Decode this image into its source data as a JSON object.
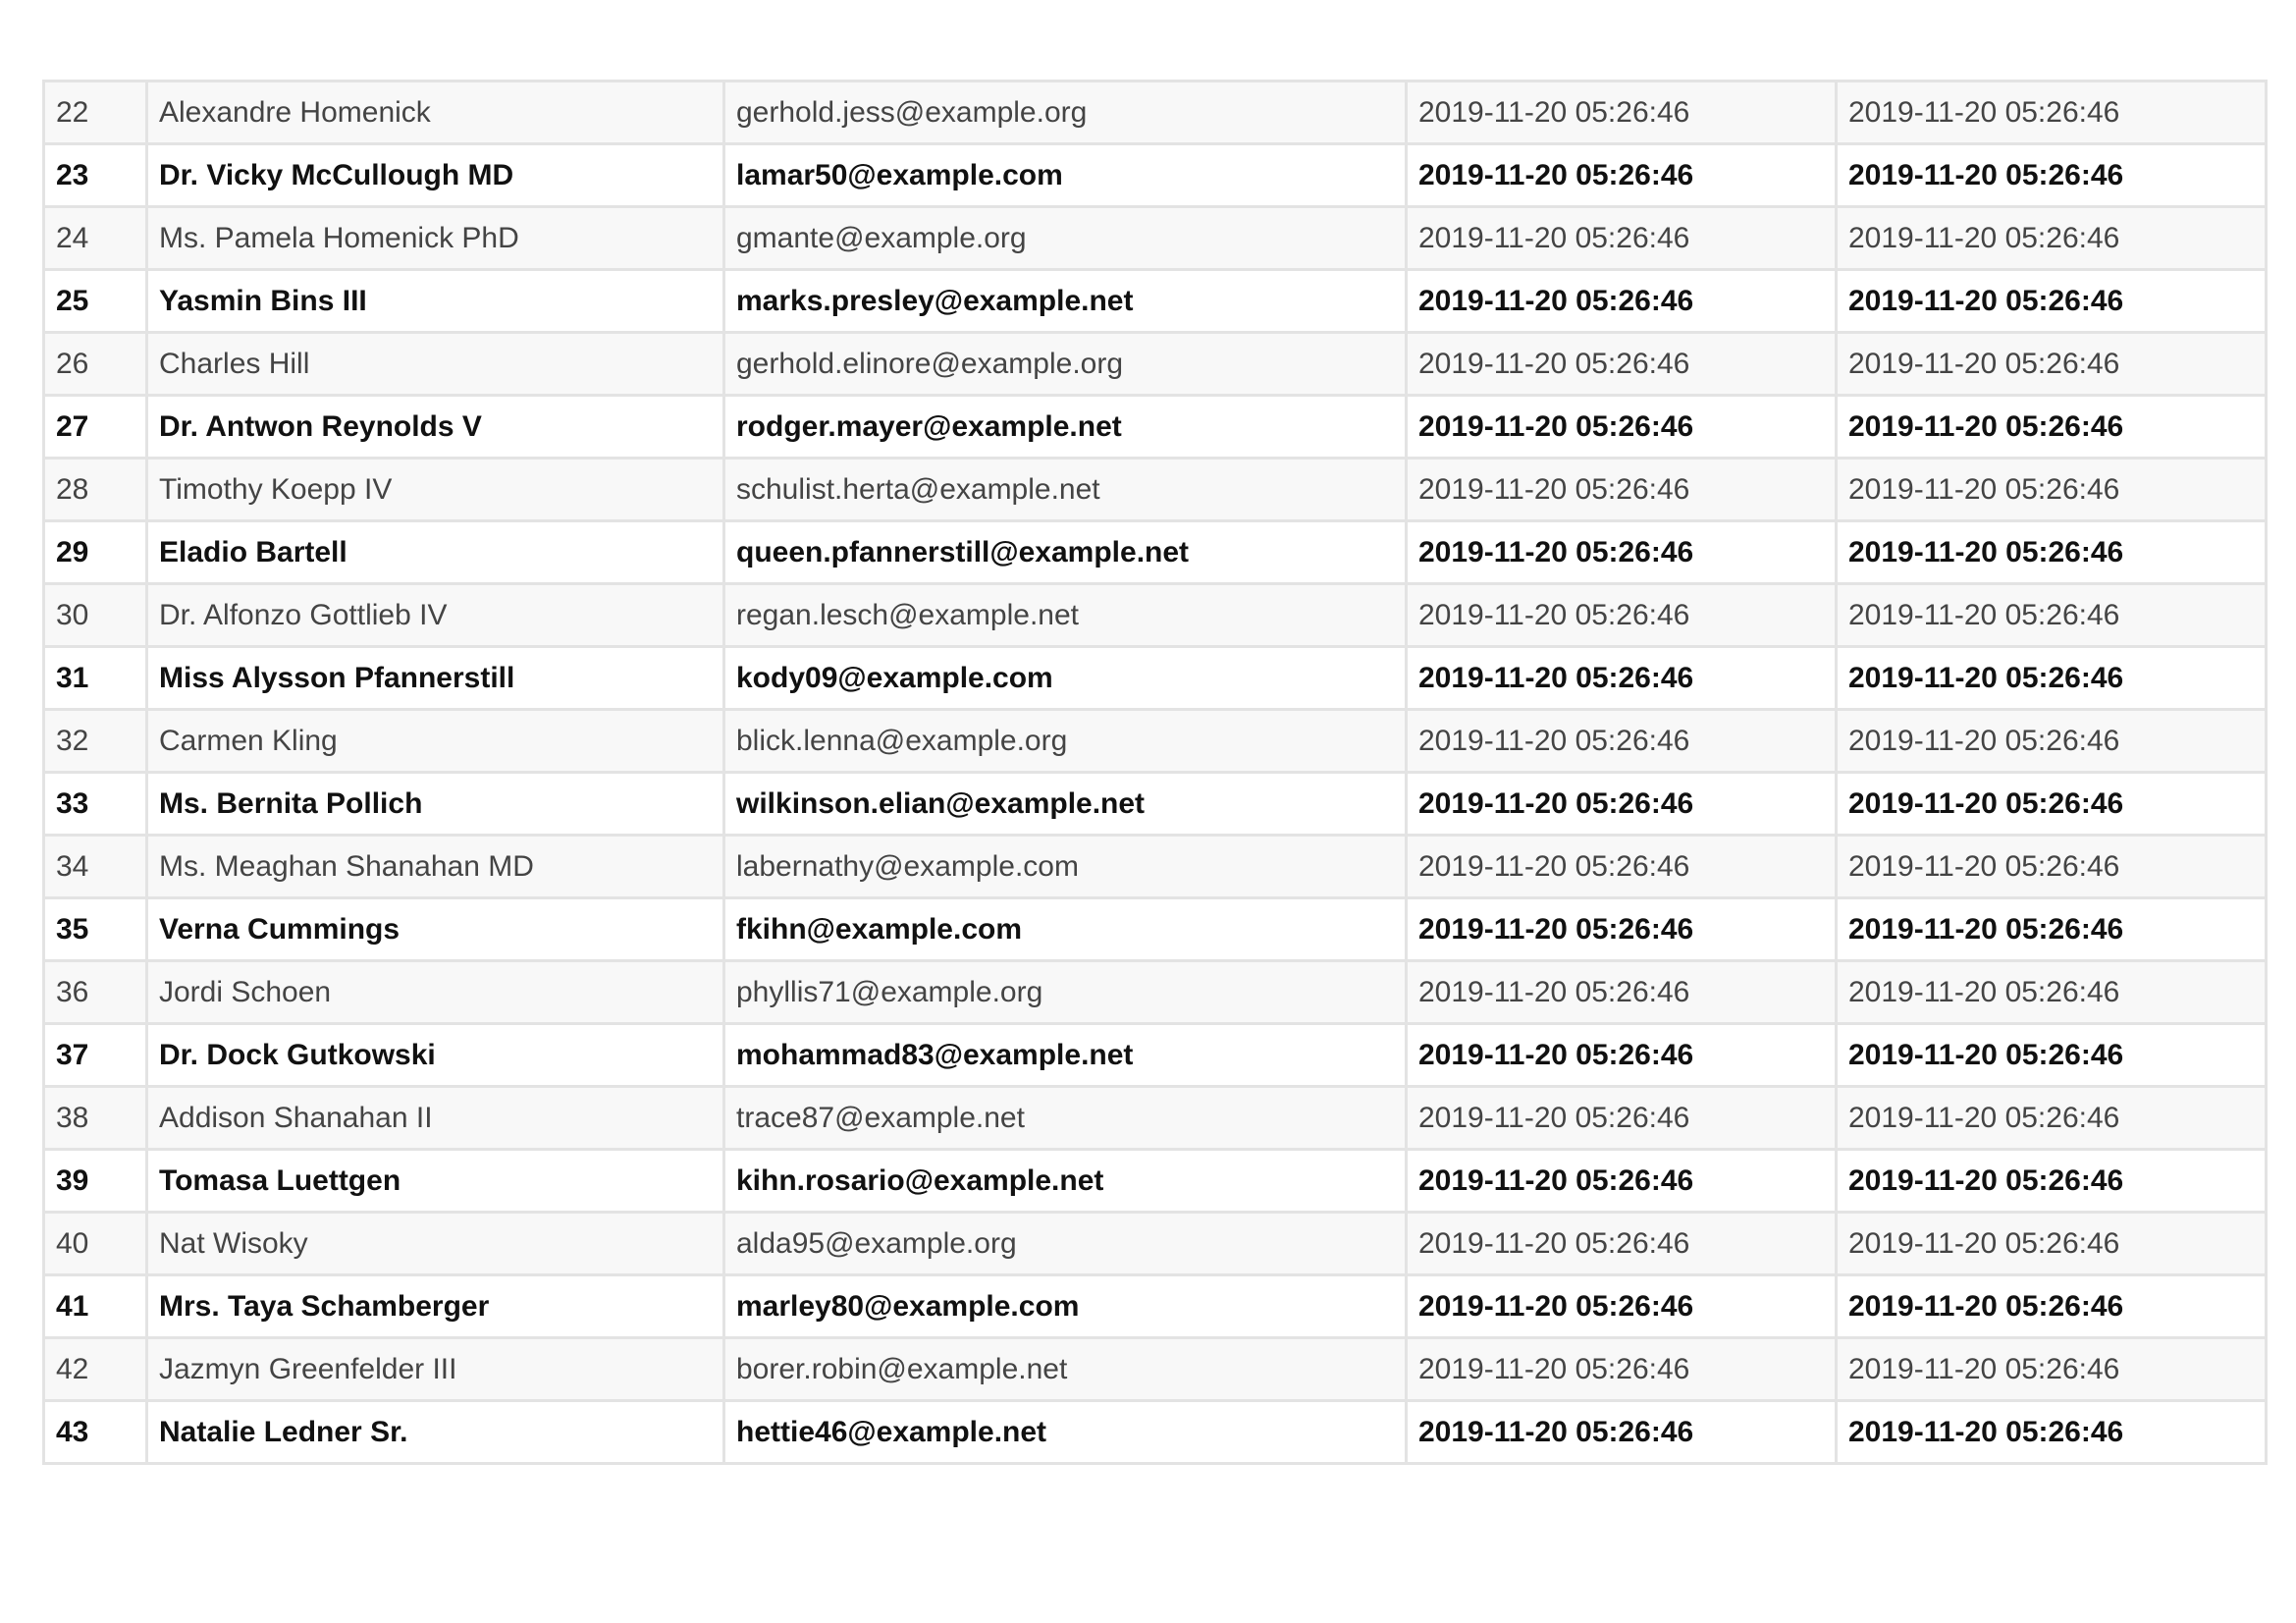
{
  "table": {
    "rows": [
      {
        "id": "22",
        "name": "Alexandre Homenick",
        "email": "gerhold.jess@example.org",
        "created_at": "2019-11-20 05:26:46",
        "updated_at": "2019-11-20 05:26:46"
      },
      {
        "id": "23",
        "name": "Dr. Vicky McCullough MD",
        "email": "lamar50@example.com",
        "created_at": "2019-11-20 05:26:46",
        "updated_at": "2019-11-20 05:26:46"
      },
      {
        "id": "24",
        "name": "Ms. Pamela Homenick PhD",
        "email": "gmante@example.org",
        "created_at": "2019-11-20 05:26:46",
        "updated_at": "2019-11-20 05:26:46"
      },
      {
        "id": "25",
        "name": "Yasmin Bins III",
        "email": "marks.presley@example.net",
        "created_at": "2019-11-20 05:26:46",
        "updated_at": "2019-11-20 05:26:46"
      },
      {
        "id": "26",
        "name": "Charles Hill",
        "email": "gerhold.elinore@example.org",
        "created_at": "2019-11-20 05:26:46",
        "updated_at": "2019-11-20 05:26:46"
      },
      {
        "id": "27",
        "name": "Dr. Antwon Reynolds V",
        "email": "rodger.mayer@example.net",
        "created_at": "2019-11-20 05:26:46",
        "updated_at": "2019-11-20 05:26:46"
      },
      {
        "id": "28",
        "name": "Timothy Koepp IV",
        "email": "schulist.herta@example.net",
        "created_at": "2019-11-20 05:26:46",
        "updated_at": "2019-11-20 05:26:46"
      },
      {
        "id": "29",
        "name": "Eladio Bartell",
        "email": "queen.pfannerstill@example.net",
        "created_at": "2019-11-20 05:26:46",
        "updated_at": "2019-11-20 05:26:46"
      },
      {
        "id": "30",
        "name": "Dr. Alfonzo Gottlieb IV",
        "email": "regan.lesch@example.net",
        "created_at": "2019-11-20 05:26:46",
        "updated_at": "2019-11-20 05:26:46"
      },
      {
        "id": "31",
        "name": "Miss Alysson Pfannerstill",
        "email": "kody09@example.com",
        "created_at": "2019-11-20 05:26:46",
        "updated_at": "2019-11-20 05:26:46"
      },
      {
        "id": "32",
        "name": "Carmen Kling",
        "email": "blick.lenna@example.org",
        "created_at": "2019-11-20 05:26:46",
        "updated_at": "2019-11-20 05:26:46"
      },
      {
        "id": "33",
        "name": "Ms. Bernita Pollich",
        "email": "wilkinson.elian@example.net",
        "created_at": "2019-11-20 05:26:46",
        "updated_at": "2019-11-20 05:26:46"
      },
      {
        "id": "34",
        "name": "Ms. Meaghan Shanahan MD",
        "email": "labernathy@example.com",
        "created_at": "2019-11-20 05:26:46",
        "updated_at": "2019-11-20 05:26:46"
      },
      {
        "id": "35",
        "name": "Verna Cummings",
        "email": "fkihn@example.com",
        "created_at": "2019-11-20 05:26:46",
        "updated_at": "2019-11-20 05:26:46"
      },
      {
        "id": "36",
        "name": "Jordi Schoen",
        "email": "phyllis71@example.org",
        "created_at": "2019-11-20 05:26:46",
        "updated_at": "2019-11-20 05:26:46"
      },
      {
        "id": "37",
        "name": "Dr. Dock Gutkowski",
        "email": "mohammad83@example.net",
        "created_at": "2019-11-20 05:26:46",
        "updated_at": "2019-11-20 05:26:46"
      },
      {
        "id": "38",
        "name": "Addison Shanahan II",
        "email": "trace87@example.net",
        "created_at": "2019-11-20 05:26:46",
        "updated_at": "2019-11-20 05:26:46"
      },
      {
        "id": "39",
        "name": "Tomasa Luettgen",
        "email": "kihn.rosario@example.net",
        "created_at": "2019-11-20 05:26:46",
        "updated_at": "2019-11-20 05:26:46"
      },
      {
        "id": "40",
        "name": "Nat Wisoky",
        "email": "alda95@example.org",
        "created_at": "2019-11-20 05:26:46",
        "updated_at": "2019-11-20 05:26:46"
      },
      {
        "id": "41",
        "name": "Mrs. Taya Schamberger",
        "email": "marley80@example.com",
        "created_at": "2019-11-20 05:26:46",
        "updated_at": "2019-11-20 05:26:46"
      },
      {
        "id": "42",
        "name": "Jazmyn Greenfelder III",
        "email": "borer.robin@example.net",
        "created_at": "2019-11-20 05:26:46",
        "updated_at": "2019-11-20 05:26:46"
      },
      {
        "id": "43",
        "name": "Natalie Ledner Sr.",
        "email": "hettie46@example.net",
        "created_at": "2019-11-20 05:26:46",
        "updated_at": "2019-11-20 05:26:46"
      }
    ]
  }
}
